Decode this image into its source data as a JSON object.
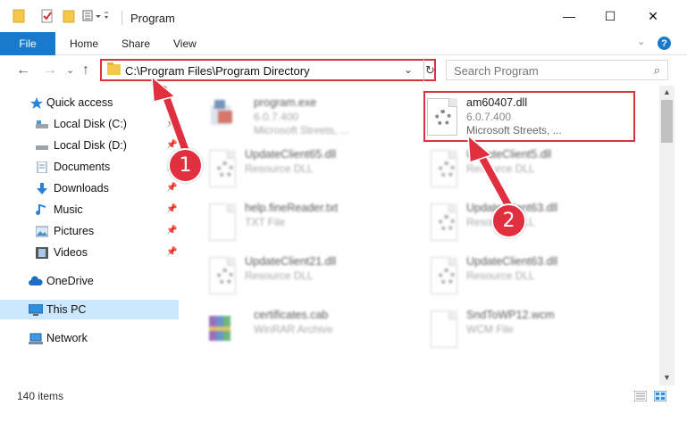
{
  "window": {
    "title": "Program",
    "minimize_symbol": "—",
    "maximize_symbol": "☐",
    "close_symbol": "✕"
  },
  "ribbon": {
    "tabs": [
      "File",
      "Home",
      "Share",
      "View"
    ],
    "help_symbol": "?"
  },
  "navigation": {
    "address_path": "C:\\Program Files\\Program Directory",
    "search_placeholder": "Search Program"
  },
  "sidebar": {
    "items": [
      {
        "label": "Quick access",
        "icon": "star-icon"
      },
      {
        "label": "Local Disk (C:)",
        "icon": "drive-icon"
      },
      {
        "label": "Local Disk (D:)",
        "icon": "drive-icon"
      },
      {
        "label": "Documents",
        "icon": "documents-icon"
      },
      {
        "label": "Downloads",
        "icon": "download-icon"
      },
      {
        "label": "Music",
        "icon": "music-icon"
      },
      {
        "label": "Pictures",
        "icon": "pictures-icon"
      },
      {
        "label": "Videos",
        "icon": "videos-icon"
      },
      {
        "label": "OneDrive",
        "icon": "cloud-icon"
      },
      {
        "label": "This PC",
        "icon": "computer-icon"
      },
      {
        "label": "Network",
        "icon": "network-icon"
      }
    ]
  },
  "files": [
    {
      "name": "program.exe",
      "line2": "6.0.7.400",
      "line3": "Microsoft Streets, ...",
      "icon": "exe-icon"
    },
    {
      "name": "am60407.dll",
      "line2": "6.0.7.400",
      "line3": "Microsoft Streets, ...",
      "icon": "dll-icon"
    },
    {
      "name": "UpdateClient65.dll",
      "line2": "Resource DLL",
      "icon": "dll-icon"
    },
    {
      "name": "UpdateClient5.dll",
      "line2": "Resource DLL",
      "icon": "dll-icon"
    },
    {
      "name": "help.fineReader.txt",
      "line2": "TXT File",
      "icon": "txt-icon"
    },
    {
      "name": "UpdateClient63.dll",
      "line2": "Resource DLL",
      "icon": "dll-icon"
    },
    {
      "name": "UpdateClient21.dll",
      "line2": "Resource DLL",
      "icon": "dll-icon"
    },
    {
      "name": "UpdateClient63.dll",
      "line2": "Resource DLL",
      "icon": "dll-icon"
    },
    {
      "name": "certificates.cab",
      "line2": "WinRAR Archive",
      "icon": "archive-icon"
    },
    {
      "name": "SndToWP12.wcm",
      "line2": "WCM File",
      "icon": "file-icon"
    }
  ],
  "status": {
    "item_count": "140 items"
  },
  "callouts": [
    "1",
    "2"
  ],
  "colors": {
    "accent": "#1979ca",
    "highlight": "#e03040",
    "selection": "#cce8ff"
  }
}
